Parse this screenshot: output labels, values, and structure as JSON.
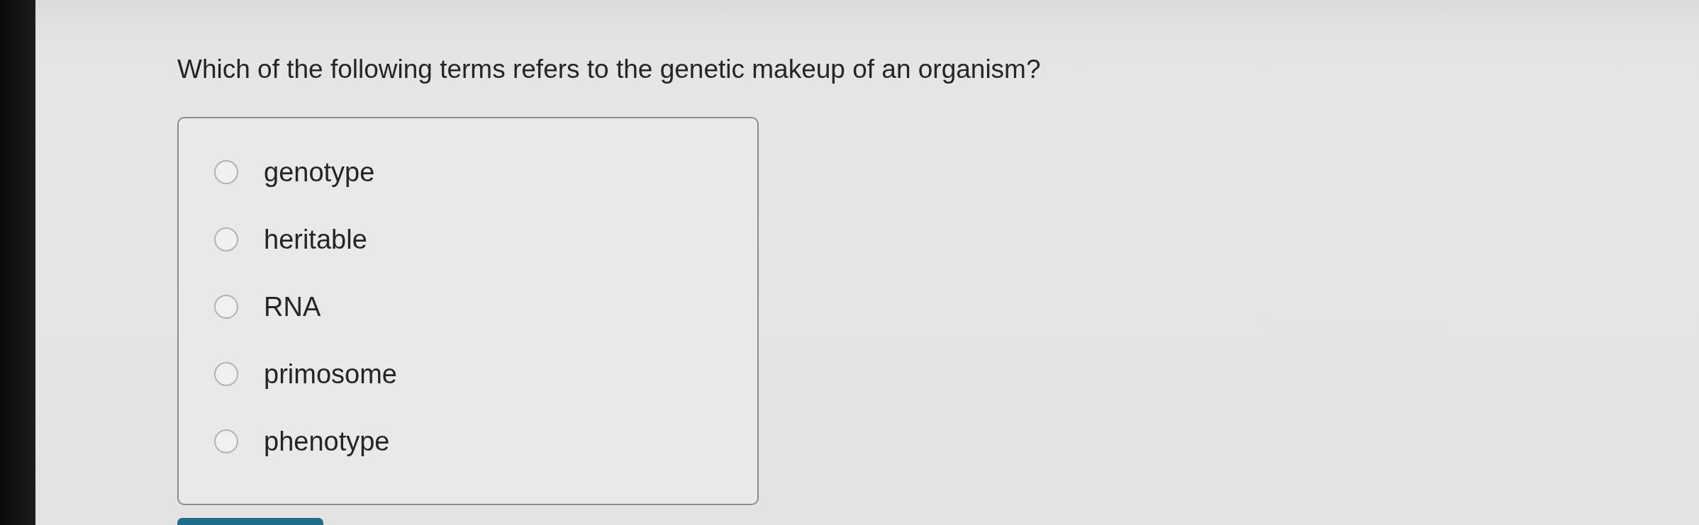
{
  "question": "Which of the following terms refers to the genetic makeup of an organism?",
  "options": [
    {
      "label": "genotype",
      "selected": false
    },
    {
      "label": "heritable",
      "selected": false
    },
    {
      "label": "RNA",
      "selected": false
    },
    {
      "label": "primosome",
      "selected": false
    },
    {
      "label": "phenotype",
      "selected": false
    }
  ]
}
